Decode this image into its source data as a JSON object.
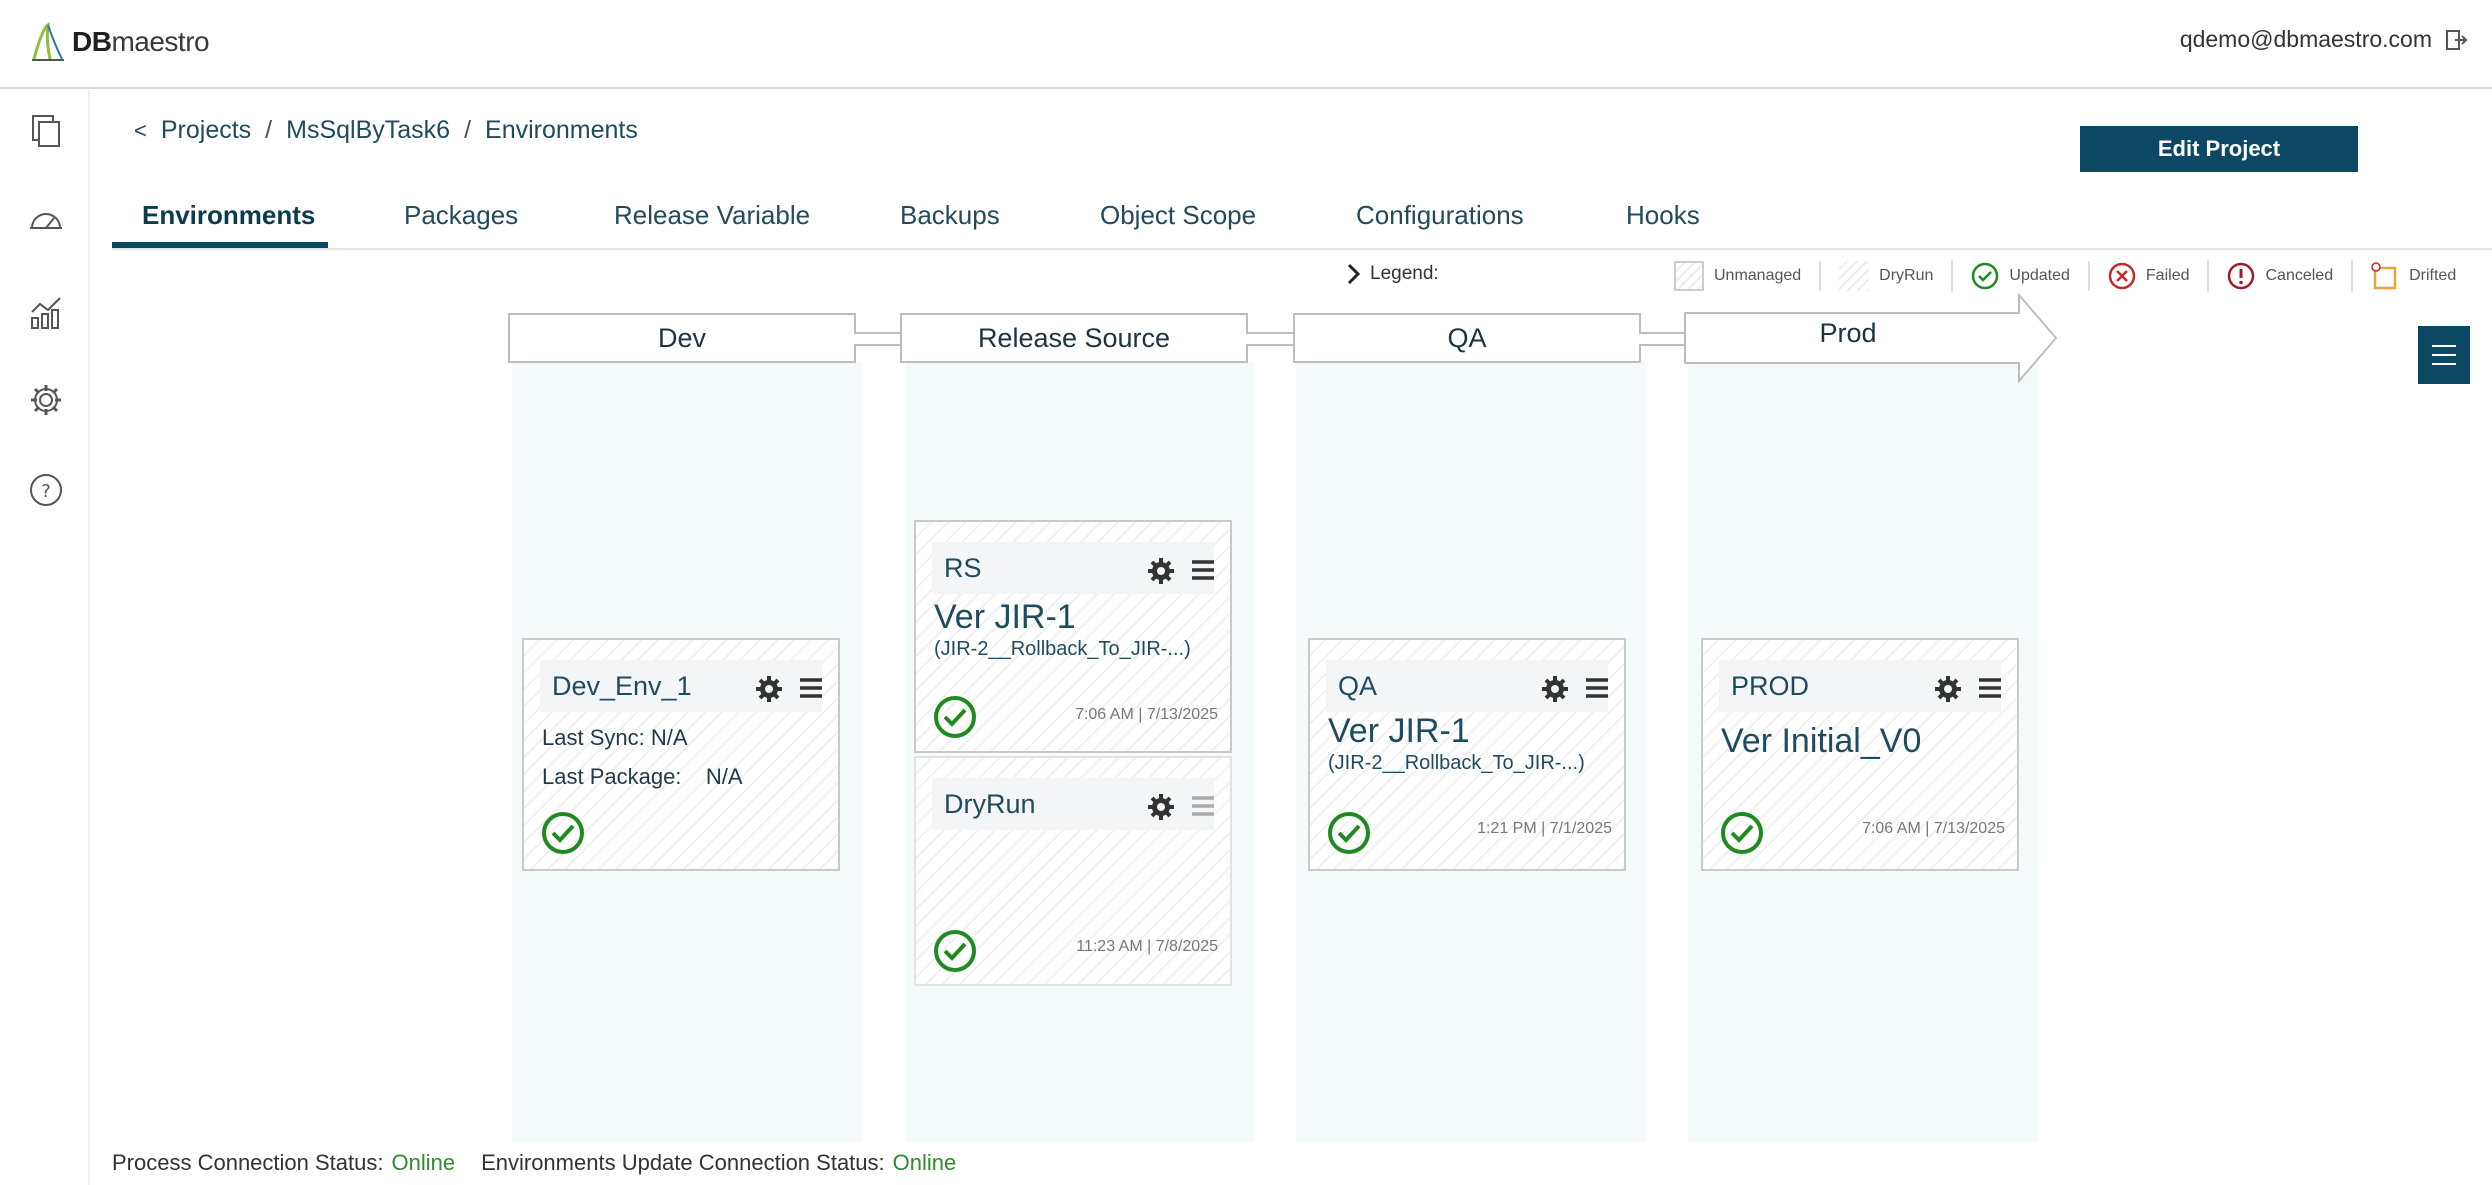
{
  "header": {
    "brand_bold": "DB",
    "brand_rest": "maestro",
    "user_email": "qdemo@dbmaestro.com"
  },
  "breadcrumb": {
    "back": "<",
    "items": [
      "Projects",
      "MsSqlByTask6",
      "Environments"
    ]
  },
  "edit_button": "Edit Project",
  "tabs": [
    "Environments",
    "Packages",
    "Release Variable",
    "Backups",
    "Object Scope",
    "Configurations",
    "Hooks"
  ],
  "legend": {
    "label": "Legend:",
    "items": [
      "Unmanaged",
      "DryRun",
      "Updated",
      "Failed",
      "Canceled",
      "Drifted"
    ]
  },
  "stages": [
    "Dev",
    "Release Source",
    "QA",
    "Prod"
  ],
  "cards": {
    "dev": {
      "title": "Dev_Env_1",
      "last_sync_label": "Last Sync:",
      "last_sync_value": "N/A",
      "last_package_label": "Last Package:",
      "last_package_value": "N/A"
    },
    "rs": {
      "title": "RS",
      "version": "Ver JIR-1",
      "detail": "(JIR-2__Rollback_To_JIR-...)",
      "timestamp": "7:06 AM | 7/13/2025"
    },
    "dryrun": {
      "title": "DryRun",
      "timestamp": "11:23 AM | 7/8/2025"
    },
    "qa": {
      "title": "QA",
      "version": "Ver JIR-1",
      "detail": "(JIR-2__Rollback_To_JIR-...)",
      "timestamp": "1:21 PM | 7/1/2025"
    },
    "prod": {
      "title": "PROD",
      "version": "Ver Initial_V0",
      "timestamp": "7:06 AM | 7/13/2025"
    }
  },
  "footer": {
    "process_label": "Process Connection Status:",
    "process_value": "Online",
    "env_label": "Environments Update Connection Status:",
    "env_value": "Online"
  },
  "colors": {
    "primary": "#0c4863",
    "success": "#1f8a1f",
    "failed": "#c62828",
    "drifted": "#e8a33a",
    "online": "#2e8b2e"
  }
}
